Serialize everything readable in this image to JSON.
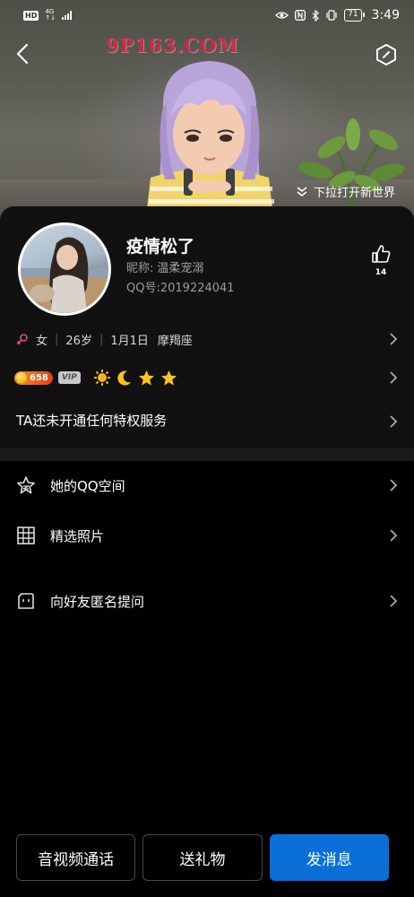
{
  "status_bar": {
    "hd_badge": "HD",
    "network_label": "4G",
    "battery_level": "71",
    "time": "3:49"
  },
  "hero": {
    "watermark": "9P163.COM",
    "pull_hint": "下拉打开新世界"
  },
  "profile": {
    "nickname": "疫情松了",
    "remark_label": "昵称:",
    "remark_value": "温柔宠溺",
    "qq_label": "QQ号:",
    "qq_number": "2019224041",
    "likes": "14",
    "info": {
      "gender": "女",
      "age": "26岁",
      "birthday": "1月1日",
      "zodiac": "摩羯座"
    },
    "level": "658",
    "vip_label": "VIP",
    "level_icons": [
      "sun-icon",
      "moon-icon",
      "star-icon",
      "star-icon"
    ],
    "privilege_text": "TA还未开通任何特权服务"
  },
  "list": [
    {
      "label": "她的QQ空间",
      "icon": "qzone-star-icon"
    },
    {
      "label": "精选照片",
      "icon": "grid-icon"
    },
    {
      "label": "向好友匿名提问",
      "icon": "question-box-icon"
    }
  ],
  "actions": {
    "call_label": "音视频通话",
    "gift_label": "送礼物",
    "message_label": "发消息"
  },
  "colors": {
    "primary_button": "#0a6fd6",
    "level_badge": "#e85a1c",
    "watermark": "#d02a48"
  }
}
